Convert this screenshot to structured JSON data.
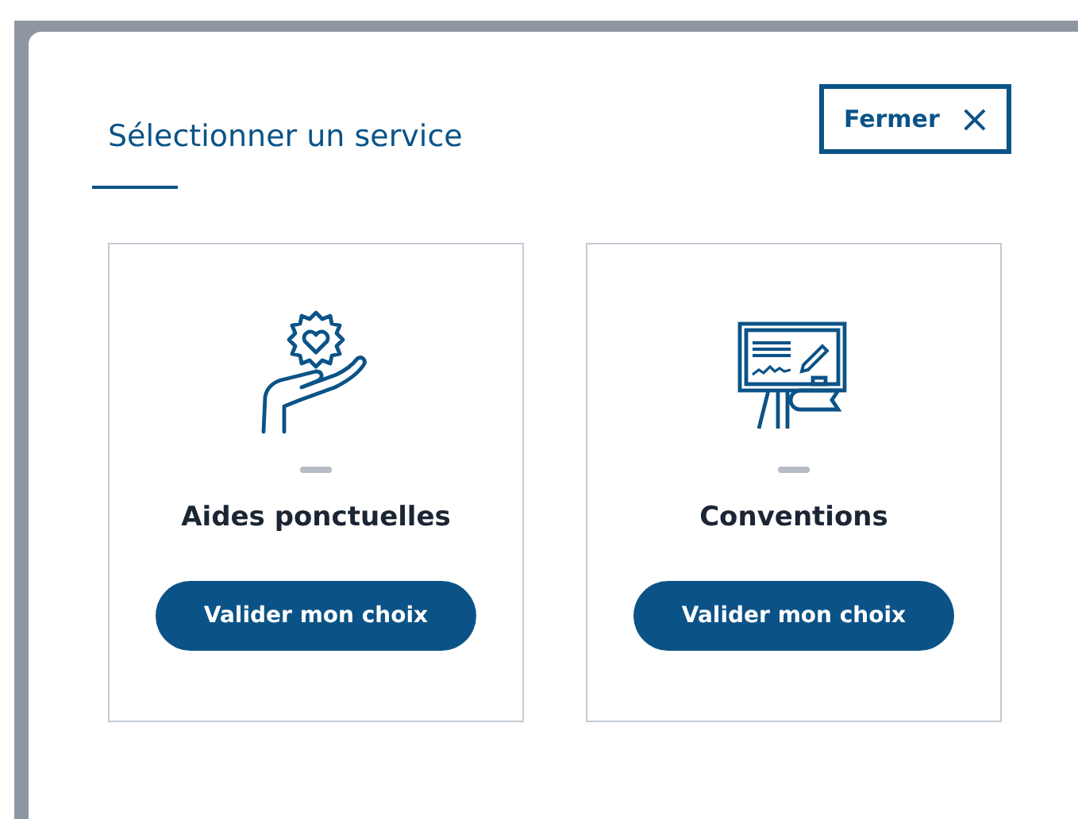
{
  "dialog": {
    "title": "Sélectionner un service",
    "close_button": {
      "label": "Fermer",
      "icon": "×"
    }
  },
  "services": [
    {
      "kind": "hand-heart",
      "name": "Aides ponctuelles",
      "button": "Valider mon choix"
    },
    {
      "kind": "easel",
      "name": "Conventions",
      "button": "Valider mon choix"
    }
  ]
}
